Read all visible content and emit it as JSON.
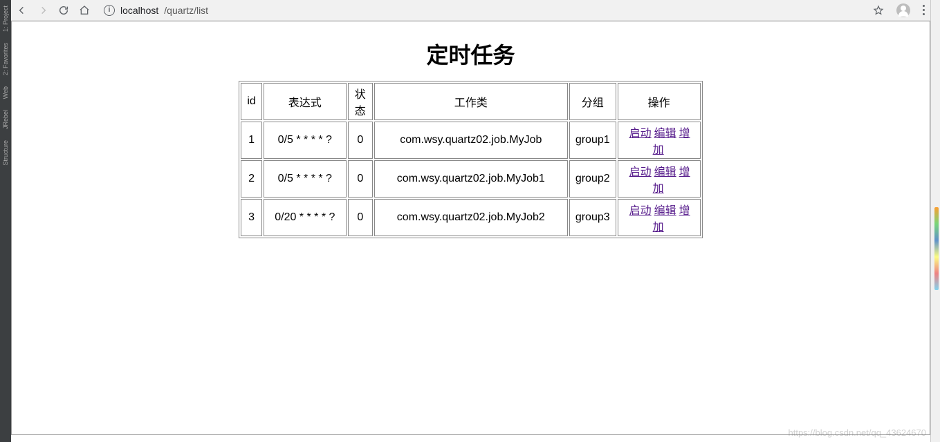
{
  "ide": {
    "tabs": [
      "1: Project",
      "2: Favorites",
      "Web",
      "JRebel",
      "Structure"
    ]
  },
  "browser": {
    "url_host": "localhost",
    "url_path": "/quartz/list"
  },
  "page": {
    "title": "定时任务",
    "headers": {
      "id": "id",
      "expression": "表达式",
      "status": "状态",
      "jobClass": "工作类",
      "group": "分组",
      "ops": "操作"
    },
    "ops_labels": {
      "start": "启动",
      "edit": "编辑",
      "add": "增加"
    },
    "rows": [
      {
        "id": "1",
        "expression": "0/5 * * * * ?",
        "status": "0",
        "jobClass": "com.wsy.quartz02.job.MyJob",
        "group": "group1"
      },
      {
        "id": "2",
        "expression": "0/5 * * * * ?",
        "status": "0",
        "jobClass": "com.wsy.quartz02.job.MyJob1",
        "group": "group2"
      },
      {
        "id": "3",
        "expression": "0/20 * * * * ?",
        "status": "0",
        "jobClass": "com.wsy.quartz02.job.MyJob2",
        "group": "group3"
      }
    ]
  },
  "watermark": "https://blog.csdn.net/qq_43624670"
}
